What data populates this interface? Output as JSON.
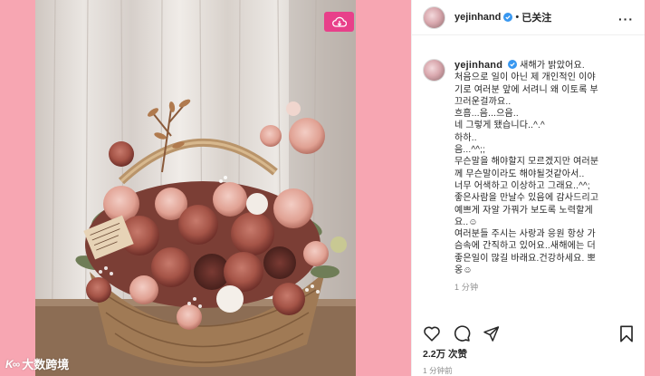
{
  "colors": {
    "background": "#f7a6b2",
    "download_button": "#e8408a",
    "verified": "#3897f0"
  },
  "watermark": {
    "logo": "K∞",
    "text": "大数跨境"
  },
  "download_button": {
    "icon": "cloud-download-icon"
  },
  "header": {
    "username": "yejinhand",
    "separator": "•",
    "follow_status": "已关注",
    "more_icon": "more-options-icon"
  },
  "caption": {
    "username": "yejinhand",
    "lines": [
      "새해가 밝았어요.",
      "처음으로 일이 아닌 제 개인적인 이야",
      "기로 여러분 앞에 서려니 왜 이토록 부",
      "끄러운걸까요..",
      "흐흠...음...으음..",
      "네 그렇게 됐습니다..^.^",
      "하하..",
      "음...^^;;",
      "무슨말을 해야할지 모르겠지만 여러분",
      "께 무슨말이라도 해야될것같아서..",
      "너무 어색하고 이상하고 그래요..^^;",
      "좋은사람을 만날수 있음에 감사드리고",
      "예쁘게 자알 가꿔가 보도록 노력할게",
      "요..☺",
      "여러분들 주시는 사랑과 응원 항상 가",
      "슴속에 간직하고 있어요..새해에는 더",
      "좋은일이 많길 바래요.건강하세요. 뽀",
      "옹☺"
    ],
    "time": "1 分钟"
  },
  "actions": {
    "like_icon": "heart-icon",
    "comment_icon": "comment-icon",
    "share_icon": "share-icon",
    "save_icon": "bookmark-icon"
  },
  "likes": "2.2万 次赞",
  "post_time": "1 分钟前"
}
